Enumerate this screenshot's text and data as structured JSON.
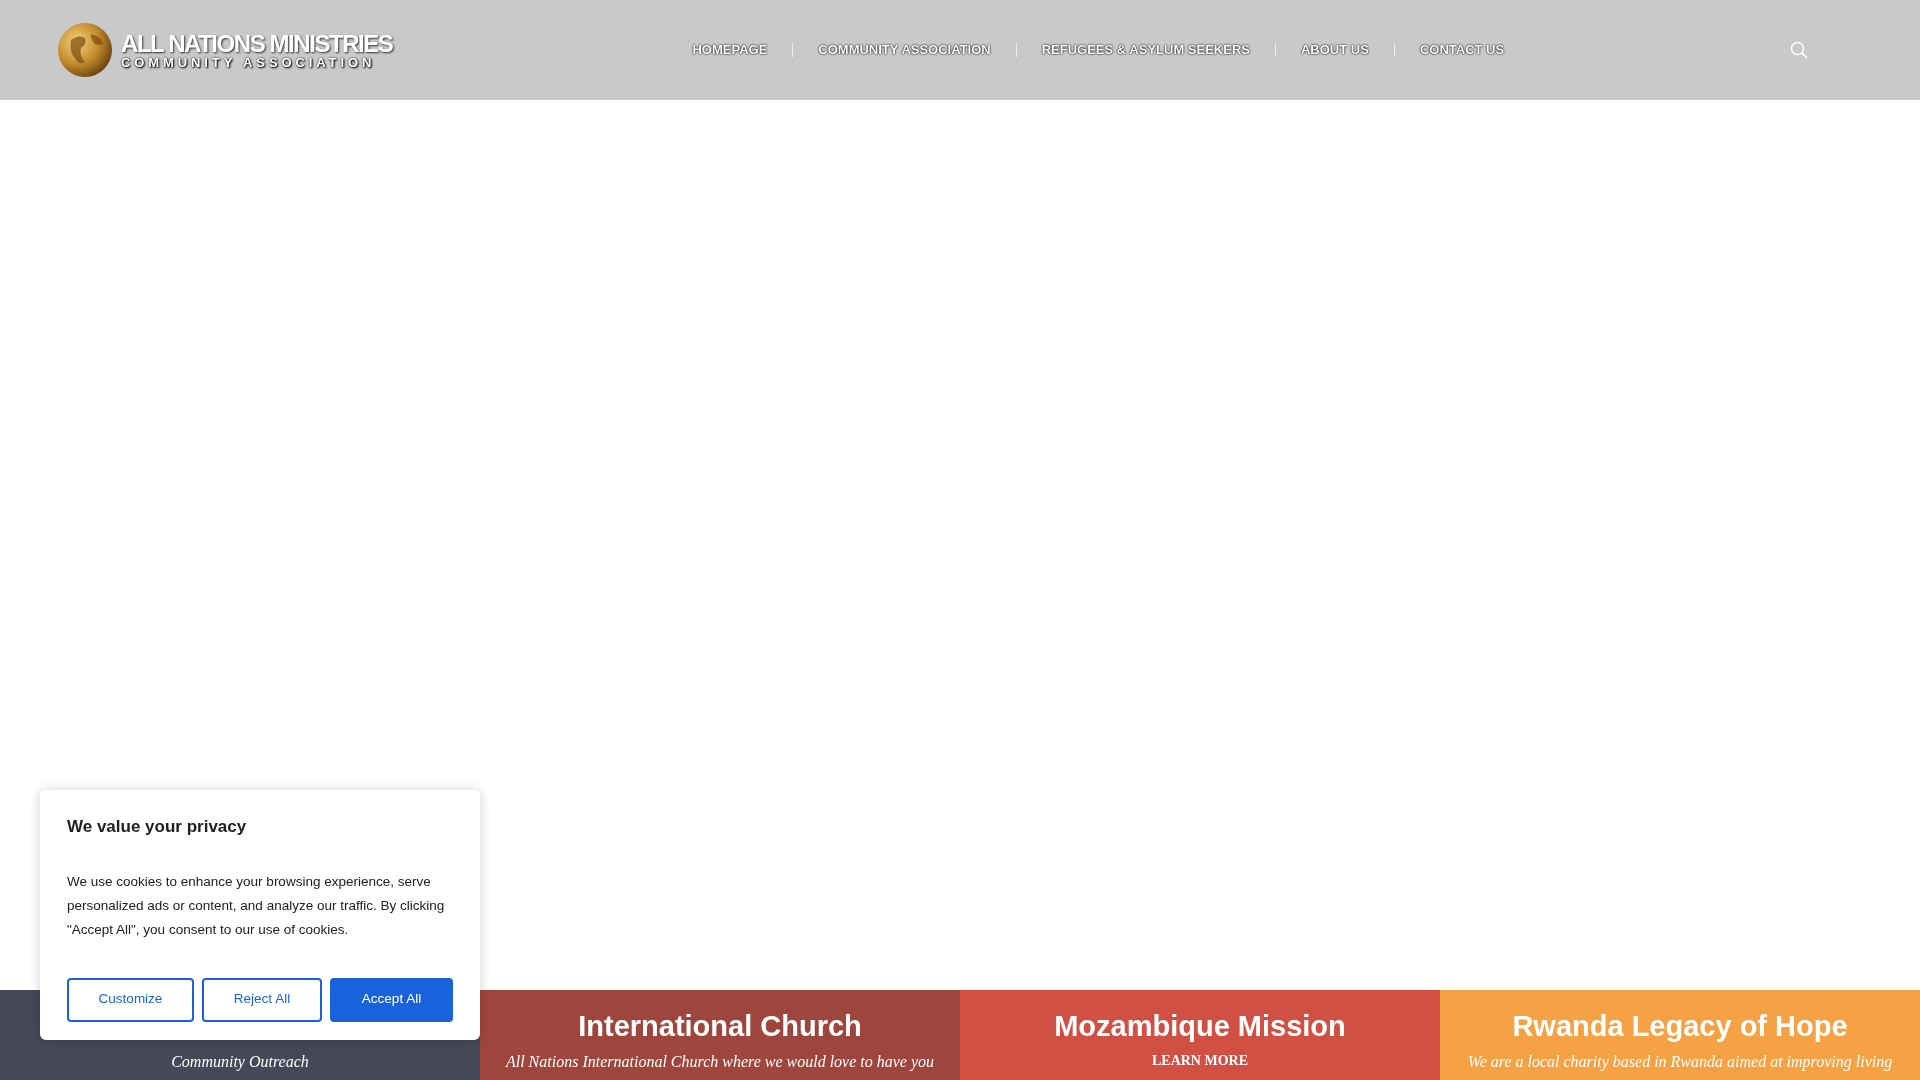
{
  "header": {
    "logo": {
      "title": "ALL NATIONS MINISTRIES",
      "subtitle": "COMMUNITY ASSOCIATION"
    },
    "nav": [
      {
        "label": "HOMEPAGE"
      },
      {
        "label": "COMMUNITY ASSOCIATION"
      },
      {
        "label": "REFUGEES & ASYLUM SEEKERS"
      },
      {
        "label": "ABOUT US"
      },
      {
        "label": "CONTACT US"
      }
    ]
  },
  "panels": [
    {
      "color": "#454857",
      "text": "Community Outreach",
      "kind": "text"
    },
    {
      "color": "#9e463d",
      "title": "International Church",
      "text": "All Nations International Church where we would love to have you",
      "kind": "text"
    },
    {
      "color": "#d05043",
      "title": "Mozambique Mission",
      "link": "LEARN MORE",
      "kind": "link"
    },
    {
      "color": "#f5a244",
      "title": "Rwanda Legacy of Hope",
      "text": "We are a local charity based in Rwanda aimed at improving living",
      "kind": "text"
    }
  ],
  "cookie_banner": {
    "title": "We value your privacy",
    "message": "We use cookies to enhance your browsing experience, serve personalized ads or content, and analyze our traffic. By clicking \"Accept All\", you consent to our use of cookies.",
    "buttons": [
      {
        "label": "Customize",
        "kind": "outline"
      },
      {
        "label": "Reject All",
        "kind": "outline"
      },
      {
        "label": "Accept All",
        "kind": "primary"
      }
    ]
  }
}
